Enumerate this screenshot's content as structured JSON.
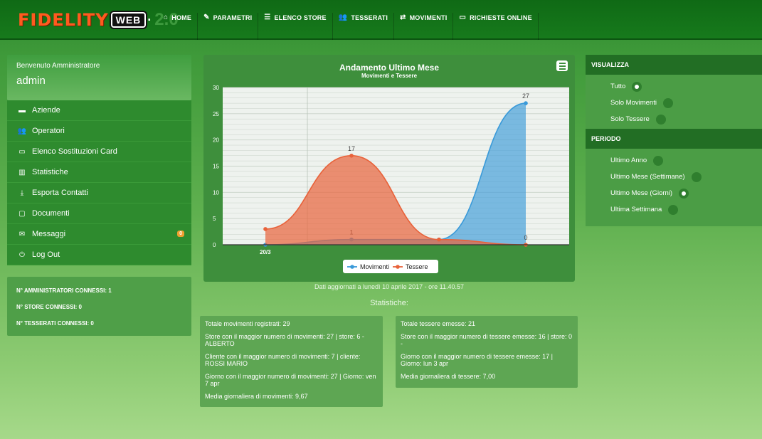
{
  "brand": {
    "name": "FIDELITY",
    "badge": "WEB",
    "version": "2.0"
  },
  "nav": [
    {
      "icon": "home-icon",
      "label": "HOME"
    },
    {
      "icon": "pencil-icon",
      "label": "PARAMETRI"
    },
    {
      "icon": "list-icon",
      "label": "ELENCO STORE"
    },
    {
      "icon": "users-icon",
      "label": "TESSERATI"
    },
    {
      "icon": "exchange-icon",
      "label": "MOVIMENTI"
    },
    {
      "icon": "laptop-icon",
      "label": "RICHIESTE ONLINE"
    }
  ],
  "sidebar": {
    "welcome": "Benvenuto Amministratore",
    "user": "admin",
    "items": [
      {
        "icon": "building-icon",
        "label": "Aziende"
      },
      {
        "icon": "users-icon",
        "label": "Operatori"
      },
      {
        "icon": "card-icon",
        "label": "Elenco Sostituzioni Card"
      },
      {
        "icon": "bar-chart-icon",
        "label": "Statistiche"
      },
      {
        "icon": "download-icon",
        "label": "Esporta Contatti"
      },
      {
        "icon": "document-icon",
        "label": "Documenti"
      },
      {
        "icon": "envelope-icon",
        "label": "Messaggi",
        "badge": "0"
      },
      {
        "icon": "power-icon",
        "label": "Log Out"
      }
    ],
    "connections": [
      "N° AMMINISTRATORI CONNESSI: 1",
      "N° STORE CONNESSI: 0",
      "N° TESSERATI CONNESSI: 0"
    ]
  },
  "chart_data": {
    "type": "area",
    "title": "Andamento Ultimo Mese",
    "subtitle": "Movimenti e Tessere",
    "x_tick_labels": [
      "20/3"
    ],
    "ylim": [
      0,
      30
    ],
    "y_ticks": [
      0,
      5,
      10,
      15,
      20,
      25,
      30
    ],
    "series": [
      {
        "name": "Movimenti",
        "color": "#3a9ad9",
        "values": [
          0,
          1,
          1,
          27
        ]
      },
      {
        "name": "Tessere",
        "color": "#e8623a",
        "values": [
          3,
          17,
          1,
          0
        ]
      }
    ],
    "data_labels": {
      "Movimenti": [
        null,
        "1",
        null,
        "27"
      ],
      "Tessere": [
        null,
        "17",
        null,
        "0"
      ]
    },
    "legend": "bottom",
    "grid": true
  },
  "updated_text": "Dati aggiornati a lunedì 10 aprile 2017 - ore 11.40.57",
  "stats_title": "Statistiche:",
  "stats_movimenti": [
    "Totale movimenti registrati: 29",
    "Store con il maggior numero di movimenti: 27 | store: 6 - ALBERTO",
    "Cliente con il maggior numero di movimenti: 7 | cliente: ROSSI MARIO",
    "Giorno con il maggior numero di movimenti: 27 | Giorno: ven 7 apr",
    "Media giornaliera di movimenti: 9,67"
  ],
  "stats_tessere": [
    "Totale tessere emesse: 21",
    "Store con il maggior numero di tessere emesse: 16 | store: 0 -",
    "Giorno con il maggior numero di tessere emesse: 17 | Giorno: lun 3 apr",
    "Media giornaliera di tessere: 7,00"
  ],
  "right_panel": {
    "visualizza_title": "VISUALIZZA",
    "visualizza": [
      {
        "label": "Tutto",
        "selected": true
      },
      {
        "label": "Solo Movimenti",
        "selected": false
      },
      {
        "label": "Solo Tessere",
        "selected": false
      }
    ],
    "periodo_title": "PERIODO",
    "periodo": [
      {
        "label": "Ultimo Anno",
        "selected": false
      },
      {
        "label": "Ultimo Mese (Settimane)",
        "selected": false
      },
      {
        "label": "Ultimo Mese (Giorni)",
        "selected": true
      },
      {
        "label": "Ultima Settimana",
        "selected": false
      }
    ]
  }
}
